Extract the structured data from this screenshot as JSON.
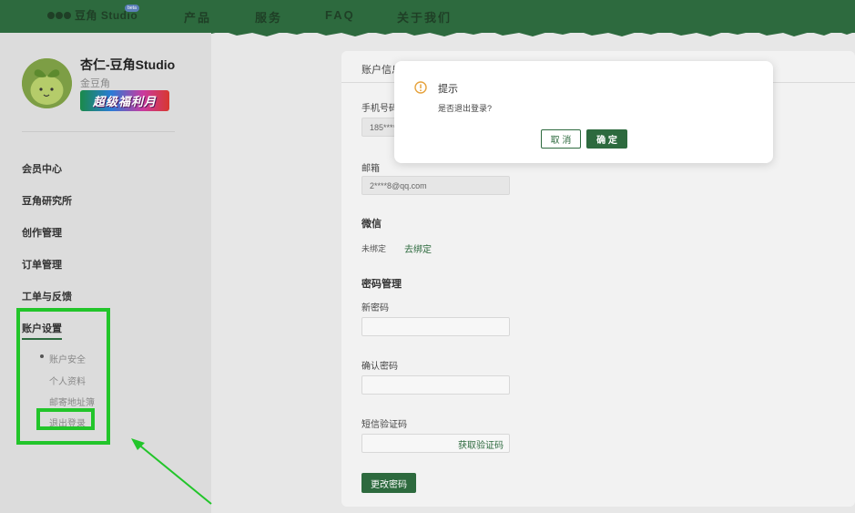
{
  "nav": {
    "logo_text": "豆角 Studio",
    "logo_badge": "beta",
    "items": [
      "产品",
      "服务",
      "FAQ",
      "关于我们"
    ]
  },
  "profile": {
    "username": "杏仁-豆角Studio",
    "level": "金豆角",
    "promo": "超级福利月"
  },
  "sidebar": {
    "menu": [
      "会员中心",
      "豆角研究所",
      "创作管理",
      "订单管理",
      "工单与反馈",
      "账户设置"
    ],
    "sub_menu": [
      "账户安全",
      "个人资料",
      "邮寄地址簿",
      "退出登录"
    ]
  },
  "account": {
    "header": "账户信息",
    "phone_label": "手机号码",
    "phone_value": "185****",
    "email_label": "邮箱",
    "email_value": "2****8@qq.com",
    "wechat_title": "微信",
    "wechat_status": "未绑定",
    "wechat_bind": "去绑定",
    "password_title": "密码管理",
    "new_password_label": "新密码",
    "confirm_password_label": "确认密码",
    "sms_label": "短信验证码",
    "get_code": "获取验证码",
    "change_password": "更改密码"
  },
  "dialog": {
    "title": "提示",
    "message": "是否退出登录?",
    "cancel": "取 消",
    "confirm": "确 定"
  },
  "colors": {
    "brand_green": "#2d6a3e",
    "highlight_green": "#22c52a",
    "warning_orange": "#e6a23c"
  }
}
